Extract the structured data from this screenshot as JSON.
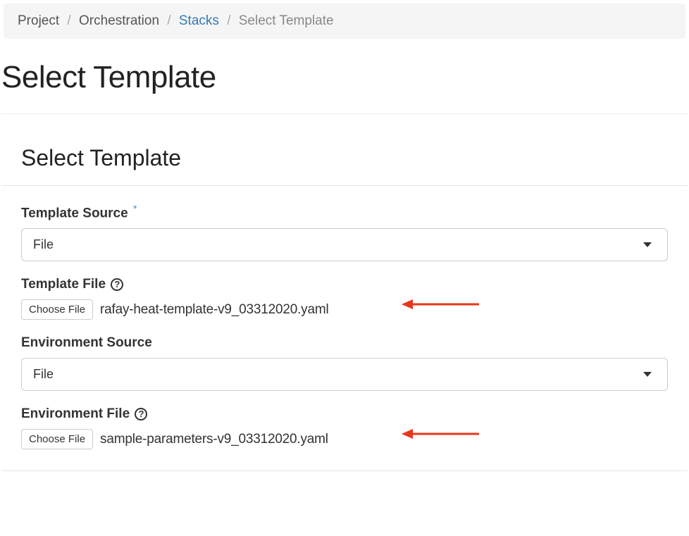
{
  "breadcrumb": {
    "project": "Project",
    "orchestration": "Orchestration",
    "stacks": "Stacks",
    "current": "Select Template"
  },
  "page": {
    "title": "Select Template"
  },
  "section": {
    "title": "Select Template"
  },
  "form": {
    "templateSource": {
      "label": "Template Source",
      "required": true,
      "selected": "File"
    },
    "templateFile": {
      "label": "Template File",
      "help": "?",
      "chooseButton": "Choose File",
      "filename": "rafay-heat-template-v9_03312020.yaml"
    },
    "environmentSource": {
      "label": "Environment Source",
      "selected": "File"
    },
    "environmentFile": {
      "label": "Environment File",
      "help": "?",
      "chooseButton": "Choose File",
      "filename": "sample-parameters-v9_03312020.yaml"
    }
  },
  "annotations": {
    "arrowColor": "#e8361c"
  }
}
